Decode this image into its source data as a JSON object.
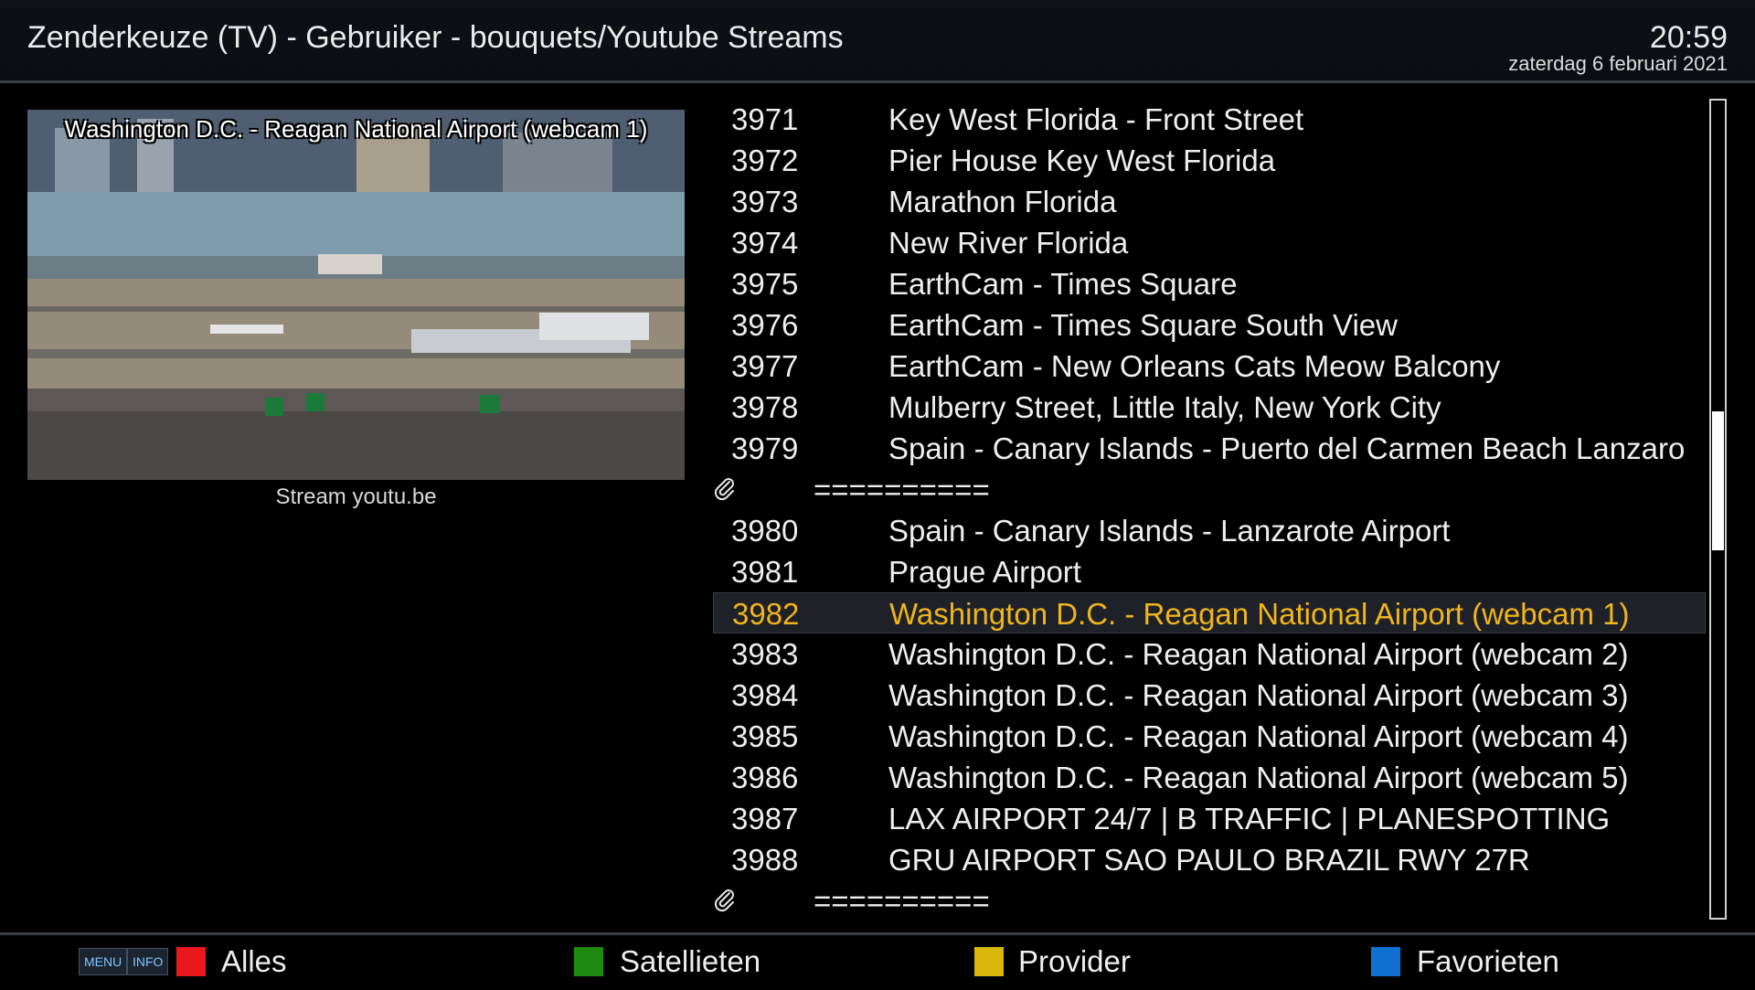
{
  "header": {
    "title": "Zenderkeuze (TV) - Gebruiker - bouquets/Youtube Streams",
    "time": "20:59",
    "date": "zaterdag  6 februari 2021"
  },
  "preview": {
    "overlay_title": "Washington D.C. - Reagan National Airport (webcam 1)",
    "stream_label": "Stream youtu.be"
  },
  "channels": [
    {
      "num": "3971",
      "name": "Key West Florida - Front Street"
    },
    {
      "num": "3972",
      "name": "Pier House Key West Florida"
    },
    {
      "num": "3973",
      "name": "Marathon Florida"
    },
    {
      "num": "3974",
      "name": "New River Florida"
    },
    {
      "num": "3975",
      "name": "EarthCam - Times Square"
    },
    {
      "num": "3976",
      "name": "EarthCam - Times Square South View"
    },
    {
      "num": "3977",
      "name": "EarthCam - New Orleans Cats Meow Balcony"
    },
    {
      "num": "3978",
      "name": "Mulberry Street, Little Italy, New York City"
    },
    {
      "num": "3979",
      "name": "Spain - Canary Islands - Puerto del Carmen Beach Lanzaro"
    },
    {
      "marker": "=========="
    },
    {
      "num": "3980",
      "name": "Spain - Canary Islands - Lanzarote Airport"
    },
    {
      "num": "3981",
      "name": "Prague Airport"
    },
    {
      "num": "3982",
      "name": "Washington D.C. - Reagan National Airport (webcam 1)"
    },
    {
      "num": "3983",
      "name": "Washington D.C. - Reagan National Airport (webcam 2)"
    },
    {
      "num": "3984",
      "name": "Washington D.C. - Reagan National Airport (webcam 3)"
    },
    {
      "num": "3985",
      "name": "Washington D.C. - Reagan National Airport (webcam 4)"
    },
    {
      "num": "3986",
      "name": "Washington D.C. - Reagan National Airport (webcam 5)"
    },
    {
      "num": "3987",
      "name": "LAX AIRPORT 24/7 | B TRAFFIC | PLANESPOTTING"
    },
    {
      "num": "3988",
      "name": "GRU AIRPORT SAO PAULO BRAZIL RWY 27R"
    },
    {
      "marker": "=========="
    }
  ],
  "selected_index": 12,
  "scroll": {
    "position_fraction": 0.38,
    "visible_fraction": 0.17
  },
  "footer": {
    "menu_key": "MENU",
    "info_key": "INFO",
    "buttons": [
      {
        "label": "Alles",
        "color": "#e8181c"
      },
      {
        "label": "Satellieten",
        "color": "#1f8a12"
      },
      {
        "label": "Provider",
        "color": "#d9b70a"
      },
      {
        "label": "Favorieten",
        "color": "#1070d0"
      }
    ]
  },
  "colors": {
    "selected_text": "#f0b41c",
    "background": "#000000"
  },
  "icons": {
    "marker": "paperclip-icon"
  }
}
